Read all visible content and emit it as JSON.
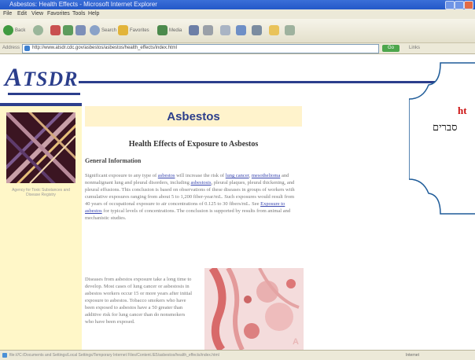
{
  "browser": {
    "window_title": "Asbestos: Health Effects - Microsoft Internet Explorer",
    "menu": [
      "File",
      "Edit",
      "View",
      "Favorites",
      "Tools",
      "Help"
    ],
    "toolbar": {
      "back_label": "Back",
      "search_label": "Search",
      "favorites_label": "Favorites",
      "media_label": "Media"
    },
    "address_label": "Address",
    "url": "http://www.atsdr.cdc.gov/asbestos/asbestos/health_effects/index.html",
    "go_label": "Go",
    "links_label": "Links",
    "status_text": "file:///C:/Documents and Settings/Local Settings/Temporary Internet Files/Content.IE5/asbestos/health_effects/index.html",
    "zone_label": "Internet"
  },
  "page": {
    "logo_big": "A",
    "logo_rest": "TSDR",
    "sidebar_caption": "Agency for Toxic Substances and Disease Registry",
    "title": "Asbestos",
    "subtitle": "Health Effects of Exposure to Asbestos",
    "section_head": "General Information",
    "paragraph1": {
      "intro": "Significant exposure to any type of ",
      "link1": "asbestos",
      "mid1": " will increase the risk of ",
      "link2": "lung cancer",
      "mid2": ", ",
      "link3": "mesothelioma",
      "mid3": " and nonmalignant lung and pleural disorders, including ",
      "link4": "asbestosis",
      "rest": ", pleural plaques, pleural thickening, and pleural effusions. This conclusion is based on observations of these diseases in groups of workers with cumulative exposures ranging from about 5 to 1,200 fiber-year/mL. Such exposures would result from 40 years of occupational exposure to air concentrations of 0.125 to 30 fibers/mL. See ",
      "link5": "Exposure to asbestos",
      "tail": " for typical levels of concentrations. The conclusion is supported by results from animal and mechanistic studies."
    },
    "paragraph2": "Diseases from asbestos exposure take a long time to develop. Most cases of lung cancer or asbestosis in asbestos workers occur 15 or more years after initial exposure to asbestos. Tobacco smokers who have been exposed to asbestos have a 50 greater than additive risk for lung cancer than do nonsmokers who have been exposed.",
    "micrograph_label": "A"
  },
  "annotation": {
    "line1": "ht",
    "line2": "סברים"
  },
  "colors": {
    "brand_blue": "#2b3e8c",
    "sidebar_yellow": "#fff7c8",
    "callout_blue": "#1f5c99",
    "callout_red": "#cc1111"
  }
}
